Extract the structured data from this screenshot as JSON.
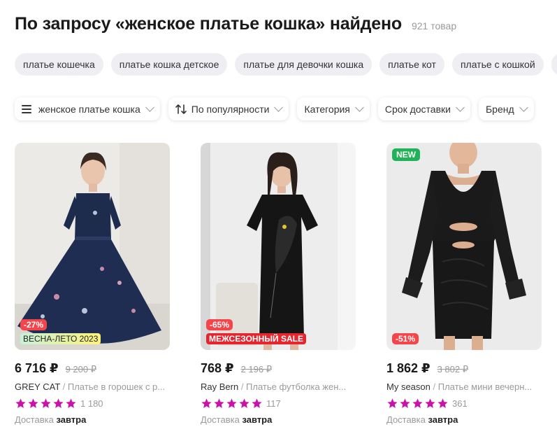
{
  "header": {
    "title": "По запросу «женское платье кошка» найдено",
    "count": "921 товар"
  },
  "suggestions": [
    "платье кошечка",
    "платье кошка детское",
    "платье для девочки кошка",
    "платье кот",
    "платье с кошкой"
  ],
  "filters": {
    "query": "женское платье кошка",
    "sort": "По популярности",
    "category": "Категория",
    "delivery": "Срок доставки",
    "brand": "Бренд"
  },
  "colors": {
    "star": "#cb11ab",
    "discount_badge": "#f5454b",
    "new_badge": "#20b258"
  },
  "icons": [
    "menu-icon",
    "sort-icon",
    "chevron-down-icon",
    "star-icon"
  ],
  "products": [
    {
      "badge_new": "",
      "discount": "-27%",
      "promo": "ВЕСНА-ЛЕТО 2023",
      "price": "6 716 ₽",
      "old_price": "9 200 ₽",
      "brand": "GREY CAT",
      "name": "Платье в горошек с р...",
      "rating": 5,
      "reviews": "1 180",
      "delivery_label": "Доставка",
      "delivery_day": "завтра"
    },
    {
      "badge_new": "",
      "discount": "-65%",
      "promo": "МЕЖСЕЗОННЫЙ SALE",
      "price": "768 ₽",
      "old_price": "2 196 ₽",
      "brand": "Ray Bern",
      "name": "Платье футболка жен...",
      "rating": 5,
      "reviews": "117",
      "delivery_label": "Доставка",
      "delivery_day": "завтра"
    },
    {
      "badge_new": "NEW",
      "discount": "-51%",
      "promo": "",
      "price": "1 862 ₽",
      "old_price": "3 802 ₽",
      "brand": "My season",
      "name": "Платье мини вечерн...",
      "rating": 5,
      "reviews": "361",
      "delivery_label": "Доставка",
      "delivery_day": "завтра"
    }
  ]
}
